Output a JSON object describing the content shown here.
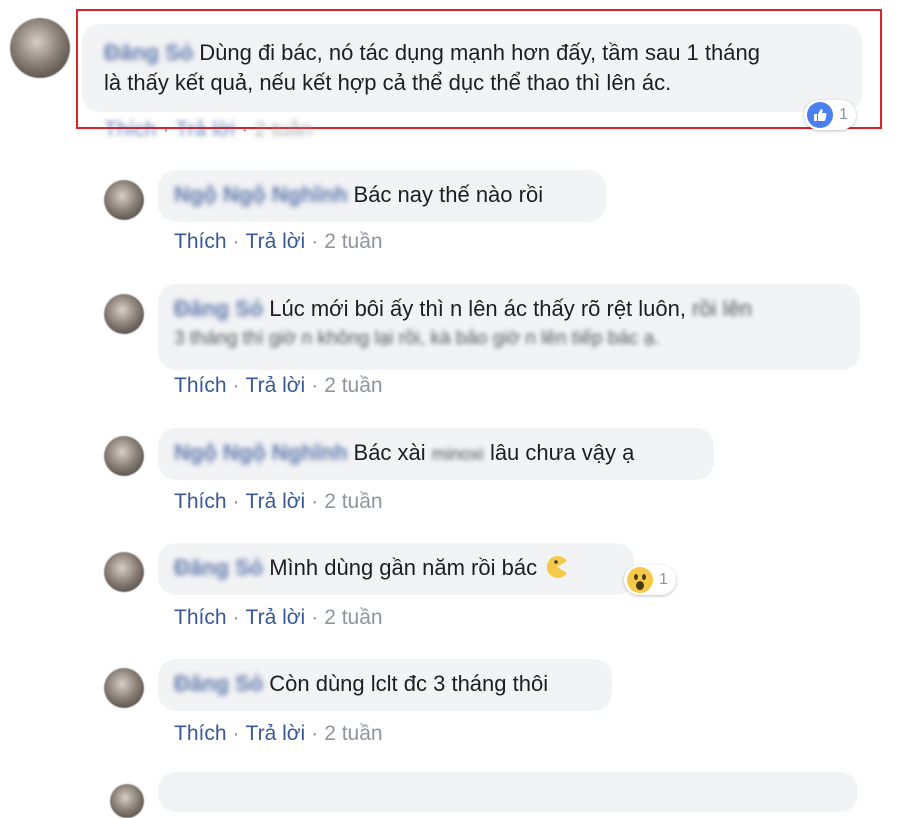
{
  "time_label": "2 tuần",
  "like_label": "Thích",
  "reply_label": "Trả lời",
  "comments": [
    {
      "author": "Đăng Sỏ",
      "text": "Dùng đi bác, nó tác dụng mạnh hơn đấy, tầm sau 1 tháng",
      "text2": "là thấy kết quả, nếu kết hợp cả thể dục thể thao thì lên ác.",
      "reaction": "like-icon",
      "reaction_count": "1"
    },
    {
      "author": "Ngộ Ngộ Nghĩnh",
      "text": "Bác nay thế nào rồi"
    },
    {
      "author": "Đăng Sỏ",
      "text": "Lúc mới bôi ấy thì n lên ác thấy rõ rệt luôn,",
      "text_blurred": "rồi lên",
      "text2_blurred": "3 tháng thì giờ n không lại rồi, kà bảo giờ n lên tiếp bác ạ."
    },
    {
      "author": "Ngộ Ngộ Nghĩnh",
      "text_a": "Bác xài",
      "text_blurred": "minoxi",
      "text_b": "lâu chưa vậy ạ"
    },
    {
      "author": "Đăng Sỏ",
      "text": "Mình dùng gần năm rồi bác",
      "emoji": "pacman-emoji",
      "reaction": "wow-icon",
      "reaction_count": "1"
    },
    {
      "author": "Đăng Sỏ",
      "text": "Còn dùng lclt đc 3 tháng thôi"
    }
  ],
  "colors": {
    "highlight_border": "#e0202a",
    "link_blue": "#385898",
    "bubble_bg": "#f2f3f5",
    "meta_gray": "#90949c"
  }
}
